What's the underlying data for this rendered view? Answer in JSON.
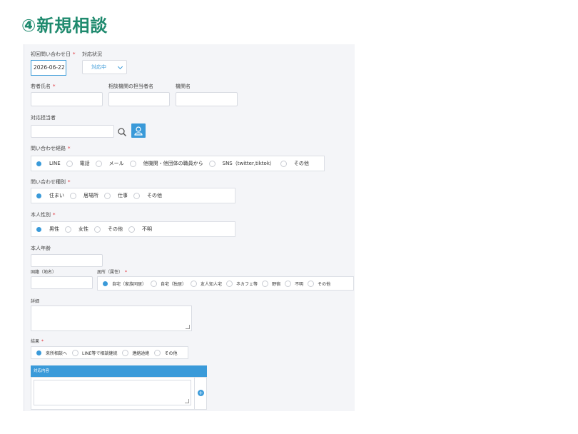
{
  "heading": "④新規相談",
  "form": {
    "first_contact_date": {
      "label": "初回問い合わせ日",
      "required": "*",
      "value": "2026-06-22"
    },
    "status": {
      "label": "対応状況",
      "value": "対応中"
    },
    "youth_name": {
      "label": "若者氏名",
      "required": "*"
    },
    "agency_staff": {
      "label": "相談機関の担当者名"
    },
    "agency_name": {
      "label": "機関名"
    },
    "handler": {
      "label": "対応担当者"
    },
    "route": {
      "label": "問い合わせ経路",
      "required": "*",
      "options": [
        "LINE",
        "電話",
        "メール",
        "他機関・他団体の職員から",
        "SNS（twitter,tiktok）",
        "その他"
      ],
      "selected": 0
    },
    "inquiry_type": {
      "label": "問い合わせ種別",
      "required": "*",
      "options": [
        "住まい",
        "居場所",
        "仕事",
        "その他"
      ],
      "selected": 0
    },
    "gender": {
      "label": "本人性別",
      "required": "*",
      "options": [
        "男性",
        "女性",
        "その他",
        "不明"
      ],
      "selected": 0
    },
    "age": {
      "label": "本人年齢"
    },
    "nationality": {
      "label": "国籍（地名）"
    },
    "residence": {
      "label": "居所（属性）",
      "required": "*",
      "options": [
        "自宅（家族同居）",
        "自宅（独居）",
        "友人知人宅",
        "ネカフェ等",
        "野宿",
        "不明",
        "その他"
      ],
      "selected": 0
    },
    "details": {
      "label": "詳細"
    },
    "result": {
      "label": "結果",
      "required": "*",
      "options": [
        "来所相談へ",
        "LINE等で相談継続",
        "連絡途絶",
        "その他"
      ],
      "selected": 0
    },
    "response_content": {
      "label": "対応内容"
    }
  },
  "colors": {
    "heading": "#1f8a6e",
    "accent": "#3a9ad9",
    "required": "#e0242c"
  },
  "icons": {
    "search": "search-icon",
    "user": "user-icon",
    "add": "plus-icon"
  }
}
